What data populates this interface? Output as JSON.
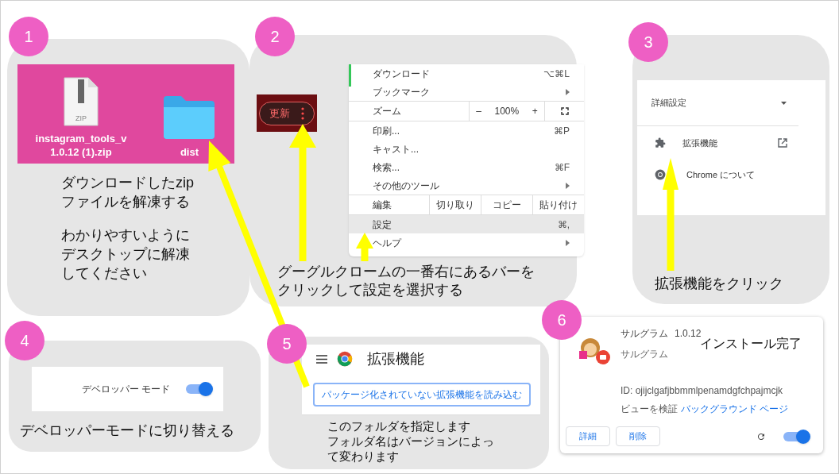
{
  "step_1": {
    "number": "1",
    "files": [
      {
        "name": "instagram_tools_v\n1.0.12 (1).zip",
        "kind": "zip",
        "icon_label": "ZIP"
      },
      {
        "name": "dist",
        "kind": "folder"
      }
    ],
    "caption": [
      [
        "ダウンロードしたzip",
        "ファイルを解凍する"
      ],
      [
        "わかりやすいように",
        "デスクトップに解凍",
        "してください"
      ]
    ]
  },
  "step_2": {
    "number": "2",
    "update_button": {
      "label": "更新"
    },
    "menu": [
      {
        "kind": "item",
        "label": "ダウンロード",
        "shortcut": "⌥⌘L",
        "submenu": false,
        "selected": false
      },
      {
        "kind": "item",
        "label": "ブックマーク",
        "submenu": true,
        "selected": false
      },
      {
        "kind": "zoom",
        "label": "ズーム",
        "minus": "–",
        "value": "100%",
        "plus": "+"
      },
      {
        "kind": "item",
        "label": "印刷...",
        "shortcut": "⌘P",
        "submenu": false,
        "selected": false
      },
      {
        "kind": "item",
        "label": "キャスト...",
        "submenu": false,
        "selected": false
      },
      {
        "kind": "item",
        "label": "検索...",
        "shortcut": "⌘F",
        "submenu": false,
        "selected": false
      },
      {
        "kind": "item",
        "label": "その他のツール",
        "submenu": true,
        "selected": false
      },
      {
        "kind": "edit",
        "label": "編集",
        "actions": [
          "切り取り",
          "コピー",
          "貼り付け"
        ]
      },
      {
        "kind": "item",
        "label": "設定",
        "shortcut": "⌘,",
        "submenu": false,
        "selected": true
      },
      {
        "kind": "item",
        "label": "ヘルプ",
        "submenu": true,
        "selected": false
      }
    ],
    "caption": [
      "グーグルクロームの一番右にあるバーを",
      "クリックして設定を選択する"
    ]
  },
  "step_3": {
    "number": "3",
    "section": "詳細設定",
    "items": [
      {
        "kind": "extensions",
        "label": "拡張機能"
      },
      {
        "kind": "about",
        "label": "Chrome について"
      }
    ],
    "caption": "拡張機能をクリック"
  },
  "step_4": {
    "number": "4",
    "toggle": {
      "label": "デベロッパー モード",
      "on": true
    },
    "caption": "デベロッパーモードに切り替える"
  },
  "step_5": {
    "number": "5",
    "title": "拡張機能",
    "load_button": "パッケージ化されていない拡張機能を読み込む",
    "caption": [
      "このフォルダを指定します",
      "フォルダ名はバージョンによっ",
      "て変わります"
    ]
  },
  "step_6": {
    "number": "6",
    "name": "サルグラム",
    "version": "1.0.12",
    "description": "サルグラム",
    "note": "インストール完了",
    "id": "ID: ojijclgafjbbmmlpenamdgfchpajmcjk",
    "inspect_label": "ビューを検証",
    "inspect_link": "バックグラウンド ページ",
    "buttons": [
      "詳細",
      "削除"
    ],
    "enabled": true
  }
}
